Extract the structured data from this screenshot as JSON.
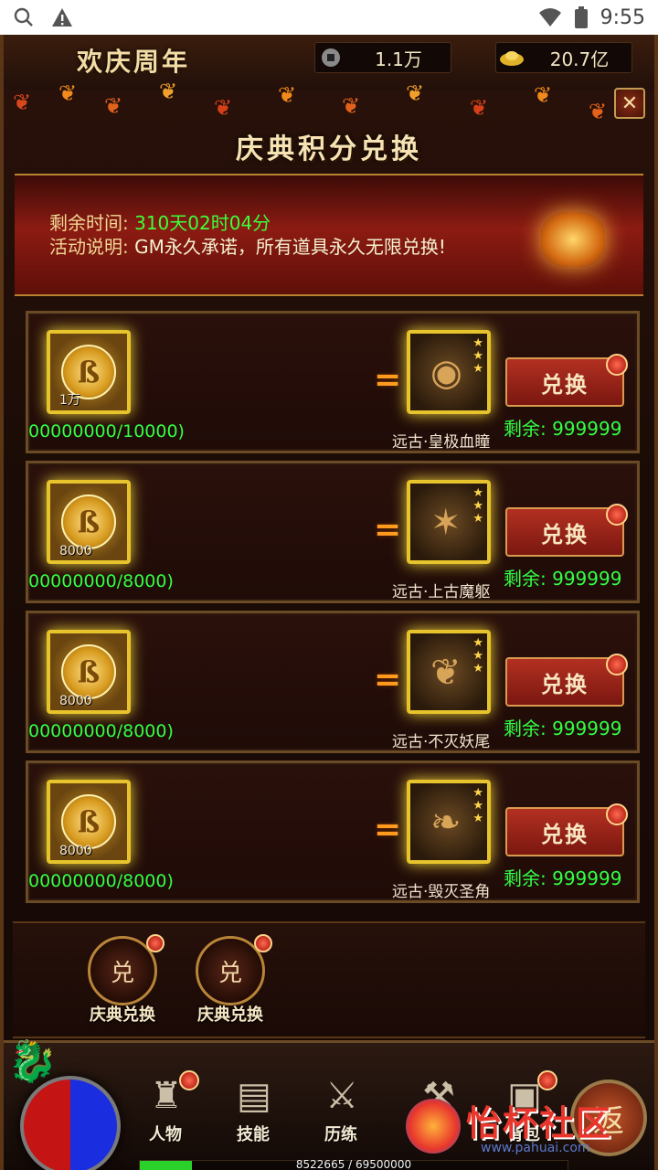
{
  "status_bar": {
    "time": "9:55"
  },
  "header": {
    "event_title": "欢庆周年",
    "copper_amount": "1.1万",
    "gold_amount": "20.7亿",
    "close_glyph": "✕"
  },
  "panel": {
    "title": "庆典积分兑换",
    "time_label": "剩余时间:",
    "time_value": "310天02时04分",
    "desc_label": "活动说明:",
    "desc_value": "GM永久承诺，所有道具永久无限兑换!"
  },
  "exchange_rows": [
    {
      "cost_amount": "1万",
      "progress": "00000000/10000)",
      "reward_name": "远古·皇极血瞳",
      "button_label": "兑换",
      "remaining": "剩余: 999999",
      "icon_name": "blood-eye-icon",
      "icon_glyph": "◉"
    },
    {
      "cost_amount": "8000",
      "progress": "00000000/8000)",
      "reward_name": "远古·上古魔躯",
      "button_label": "兑换",
      "remaining": "剩余: 999999",
      "icon_name": "demon-spine-icon",
      "icon_glyph": "✶"
    },
    {
      "cost_amount": "8000",
      "progress": "00000000/8000)",
      "reward_name": "远古·不灭妖尾",
      "button_label": "兑换",
      "remaining": "剩余: 999999",
      "icon_name": "demon-tail-icon",
      "icon_glyph": "❦"
    },
    {
      "cost_amount": "8000",
      "progress": "00000000/8000)",
      "reward_name": "远古·毁灭圣角",
      "button_label": "兑换",
      "remaining": "剩余: 999999",
      "icon_name": "holy-horn-icon",
      "icon_glyph": "❧"
    }
  ],
  "equals_sign": "=",
  "tabs": [
    {
      "label": "庆典兑换"
    },
    {
      "label": "庆典兑换"
    }
  ],
  "bottom_menu": [
    {
      "label": "人物",
      "icon": "character-icon"
    },
    {
      "label": "技能",
      "icon": "skill-book-icon"
    },
    {
      "label": "历练",
      "icon": "training-icon"
    },
    {
      "label": "",
      "icon": "forge-icon"
    },
    {
      "label": "背包",
      "icon": "backpack-icon"
    }
  ],
  "back_label": "返",
  "experience": {
    "text": "8522665 / 69500000",
    "fraction": 0.1226
  },
  "watermark": {
    "text": "怡杯社区",
    "url": "www.pahuai.com"
  },
  "colors": {
    "highlight_green": "#32ff44",
    "accent_orange": "#ff9a1f",
    "frame_gold": "#e7c42b"
  }
}
